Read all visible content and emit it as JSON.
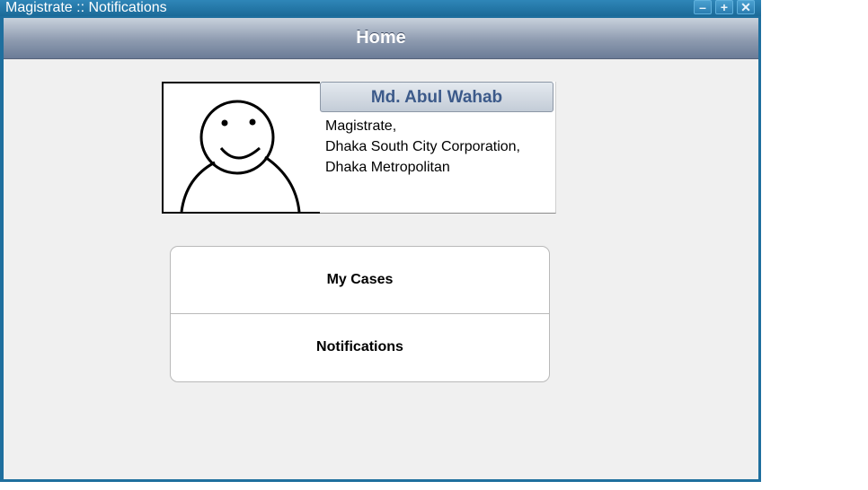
{
  "window": {
    "title": "Magistrate :: Notifications",
    "controls": [
      "–",
      "+",
      "✕"
    ]
  },
  "header": {
    "title": "Home"
  },
  "profile": {
    "name": "Md. Abul Wahab",
    "address_lines": [
      "Magistrate,",
      "Dhaka South City Corporation,",
      "Dhaka Metropolitan"
    ]
  },
  "menu": {
    "items": [
      "My Cases",
      "Notifications"
    ]
  },
  "colors": {
    "window_frame": "#1f6f9e",
    "header": "#8e9bb0",
    "name_text": "#3c5a8a"
  }
}
